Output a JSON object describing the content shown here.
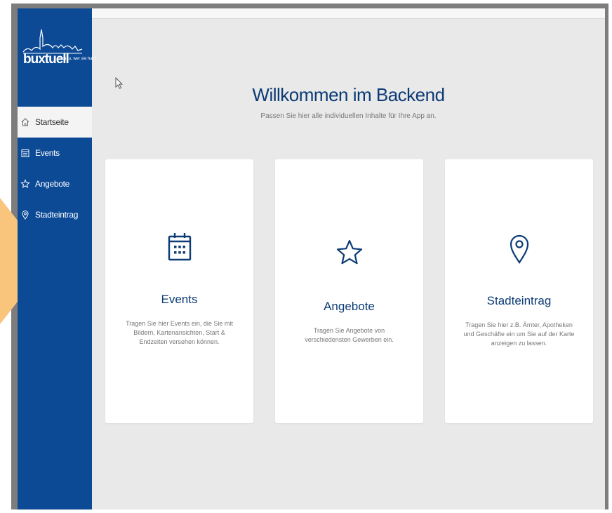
{
  "brand": {
    "name": "buxtuell",
    "tagline": "Schau, wer sie hat !"
  },
  "nav": [
    {
      "label": "Startseite",
      "icon": "home-icon",
      "active": true
    },
    {
      "label": "Events",
      "icon": "calendar-icon"
    },
    {
      "label": "Angebote",
      "icon": "star-icon"
    },
    {
      "label": "Stadteintrag",
      "icon": "map-pin-icon"
    }
  ],
  "main": {
    "title": "Willkommen im Backend",
    "subtitle": "Passen Sie hier alle individuellen Inhalte für Ihre App an."
  },
  "cards": [
    {
      "title": "Events",
      "icon": "calendar-icon",
      "text": "Tragen Sie hier Events ein, die Sie mit Bildern, Kartenansichten, Start & Endzeiten versehen können."
    },
    {
      "title": "Angebote",
      "icon": "star-icon",
      "text": "Tragen Sie Angebote von verschiedensten Gewerben ein."
    },
    {
      "title": "Stadteintrag",
      "icon": "map-pin-icon",
      "text": "Tragen Sie hier z.B. Ämter, Apotheken und Geschäfte ein um Sie auf der Karte anzeigen zu lassen."
    }
  ],
  "colors": {
    "sidebar": "#0c4a96",
    "accent": "#0c3b75",
    "callout": "#f9c57d"
  }
}
